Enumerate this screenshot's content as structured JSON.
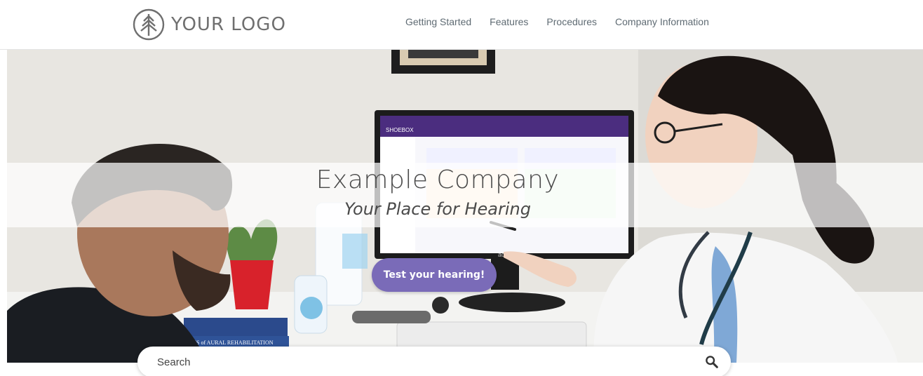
{
  "header": {
    "logo_text": "YOUR LOGO",
    "nav": [
      {
        "label": "Getting Started"
      },
      {
        "label": "Features"
      },
      {
        "label": "Procedures"
      },
      {
        "label": "Company Information"
      }
    ]
  },
  "hero": {
    "title": "Example Company",
    "subtitle": "Your Place for Hearing",
    "cta_label": "Test your hearing!",
    "monitor_app_name": "SHOEBOX",
    "book_title": "ATIONS of AURAL REHABILITATION",
    "monitor_brand": "acer"
  },
  "search": {
    "placeholder": "Search"
  },
  "colors": {
    "accent": "#7a6bb8",
    "nav_text": "#5f6b73",
    "title_text": "#4a4a4a",
    "logo": "#6f6f6f"
  },
  "icons": {
    "logo": "tree-icon",
    "search": "search-icon"
  }
}
